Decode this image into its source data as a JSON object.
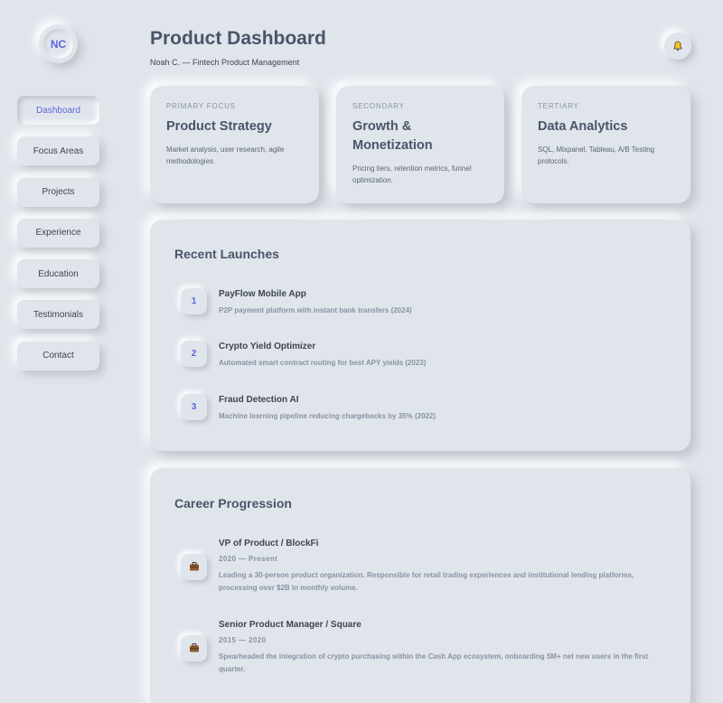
{
  "profile": {
    "initials": "NC"
  },
  "nav": {
    "items": [
      {
        "label": "Dashboard",
        "active": true
      },
      {
        "label": "Focus Areas"
      },
      {
        "label": "Projects"
      },
      {
        "label": "Experience"
      },
      {
        "label": "Education"
      },
      {
        "label": "Testimonials"
      },
      {
        "label": "Contact"
      }
    ]
  },
  "header": {
    "title": "Product Dashboard",
    "subtitle": "Noah C. — Fintech Product Management",
    "bell_icon": "bell-icon"
  },
  "focus": [
    {
      "label": "PRIMARY FOCUS",
      "heading": "Product Strategy",
      "desc": "Market analysis, user research, agile methodologies."
    },
    {
      "label": "SECONDARY",
      "heading": "Growth & Monetization",
      "desc": "Pricing tiers, retention metrics, funnel optimization."
    },
    {
      "label": "TERTIARY",
      "heading": "Data Analytics",
      "desc": "SQL, Mixpanel, Tableau, A/B Testing protocols."
    }
  ],
  "launches": {
    "title": "Recent Launches",
    "items": [
      {
        "num": "1",
        "name": "PayFlow Mobile App",
        "desc": "P2P payment platform with instant bank transfers (2024)"
      },
      {
        "num": "2",
        "name": "Crypto Yield Optimizer",
        "desc": "Automated smart contract routing for best APY yields (2023)"
      },
      {
        "num": "3",
        "name": "Fraud Detection AI",
        "desc": "Machine learning pipeline reducing chargebacks by 35% (2022)"
      }
    ]
  },
  "career": {
    "title": "Career Progression",
    "items": [
      {
        "icon": "briefcase-icon",
        "role": "VP of Product / BlockFi",
        "years": "2020 — Present",
        "desc": "Leading a 30-person product organization. Responsible for retail trading experiences and institutional lending platforms, processing over $2B in monthly volume."
      },
      {
        "icon": "briefcase-icon",
        "role": "Senior Product Manager / Square",
        "years": "2015 — 2020",
        "desc": "Spearheaded the integration of crypto purchasing within the Cash App ecosystem, onboarding 5M+ net new users in the first quarter."
      }
    ]
  },
  "colors": {
    "background": "#e0e5ec",
    "accent": "#5a67d8",
    "text": "#4a5568"
  }
}
